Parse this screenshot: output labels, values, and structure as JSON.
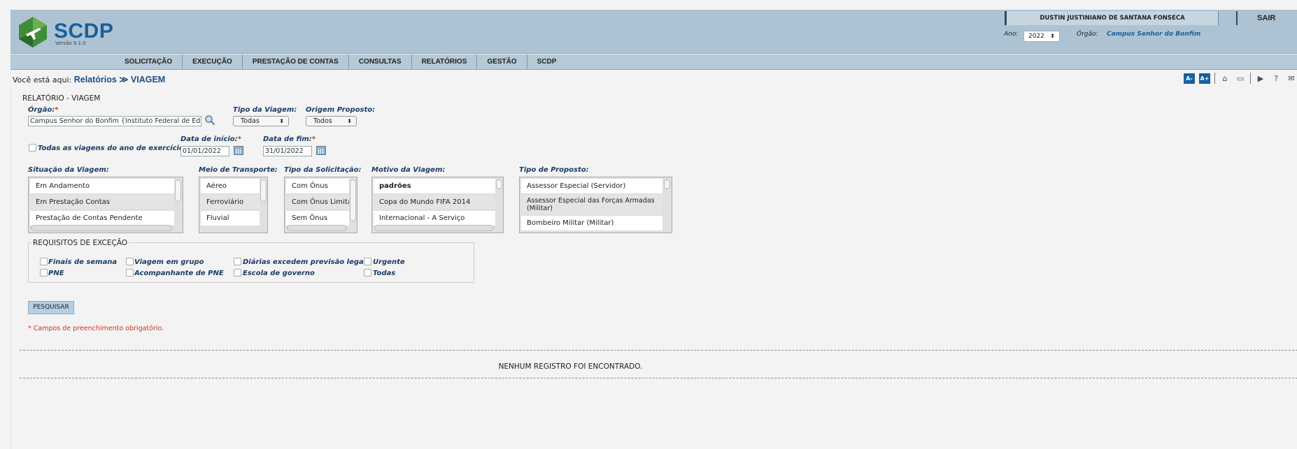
{
  "header": {
    "logo_text": "SCDP",
    "version": "Versão 9.1.0",
    "user_name": "DUSTIN JUSTINIANO DE SANTANA FONSECA",
    "logout_label": "SAIR",
    "ano_label": "Ano:",
    "ano_value": "2022",
    "orgao_label": "Órgão:",
    "orgao_value": "Campus Senhor do Bonfim"
  },
  "menu": [
    "SOLICITAÇÃO",
    "EXECUÇÃO",
    "PRESTAÇÃO DE CONTAS",
    "CONSULTAS",
    "RELATÓRIOS",
    "GESTÃO",
    "SCDP"
  ],
  "breadcrumb": {
    "prefix": "Você está aqui:",
    "path": "Relatórios ≫ VIAGEM"
  },
  "toolbar": {
    "font_decrease": "A-",
    "font_increase": "A+",
    "icons": [
      "font-decrease-icon",
      "font-increase-icon",
      "home-icon",
      "chat-icon",
      "video-icon",
      "help-icon",
      "mail-icon"
    ]
  },
  "form": {
    "section_title": "RELATÓRIO - VIAGEM",
    "orgao_label": "Órgão:",
    "orgao_value": "Campus Senhor do Bonfim {Instituto Federal de Educação",
    "tipo_viagem_label": "Tipo da Viagem:",
    "tipo_viagem_value": "Todas",
    "origem_label": "Origem Proposto:",
    "origem_value": "Todos",
    "todas_viagens_label": "Todas as viagens do ano de exercício",
    "data_inicio_label": "Data de início:",
    "data_inicio_value": "01/01/2022",
    "data_fim_label": "Data de fim:",
    "data_fim_value": "31/01/2022",
    "required_mark": "*",
    "situacao_label": "Situação da Viagem:",
    "situacao_items": [
      "Em Andamento",
      "Em Prestação Contas",
      "Prestação de Contas Pendente"
    ],
    "meio_label": "Meio de Transporte:",
    "meio_items": [
      "Aéreo",
      "Ferroviário",
      "Fluvial"
    ],
    "tipo_solic_label": "Tipo da Solicitação:",
    "tipo_solic_items": [
      "Com Ônus",
      "Com Ônus Limitado",
      "Sem Ônus"
    ],
    "motivo_label": "Motivo da Viagem:",
    "motivo_items": [
      "padrões",
      "Copa do Mundo FIFA 2014",
      "Internacional - A Serviço"
    ],
    "tipo_proposto_label": "Tipo de Proposto:",
    "tipo_proposto_items": [
      "Assessor Especial (Servidor)",
      "Assessor Especial das Forças Armadas (Militar)",
      "Bombeiro Militar (Militar)"
    ],
    "requisitos_title": "REQUISITOS DE EXCEÇÃO",
    "requisitos": [
      "Finais de semana",
      "Viagem em grupo",
      "Diárias excedem previsão legal",
      "Urgente",
      "PNE",
      "Acompanhante de PNE",
      "Escola de governo",
      "Todas"
    ],
    "search_button": "PESQUISAR",
    "required_note": "* Campos de preenchimento obrigatório."
  },
  "result": {
    "message": "NENHUM REGISTRO FOI ENCONTRADO."
  },
  "colors": {
    "header_bg": "#adc3d3",
    "accent": "#1a5f9e",
    "label": "#1a3c66",
    "required": "#d0321d"
  }
}
